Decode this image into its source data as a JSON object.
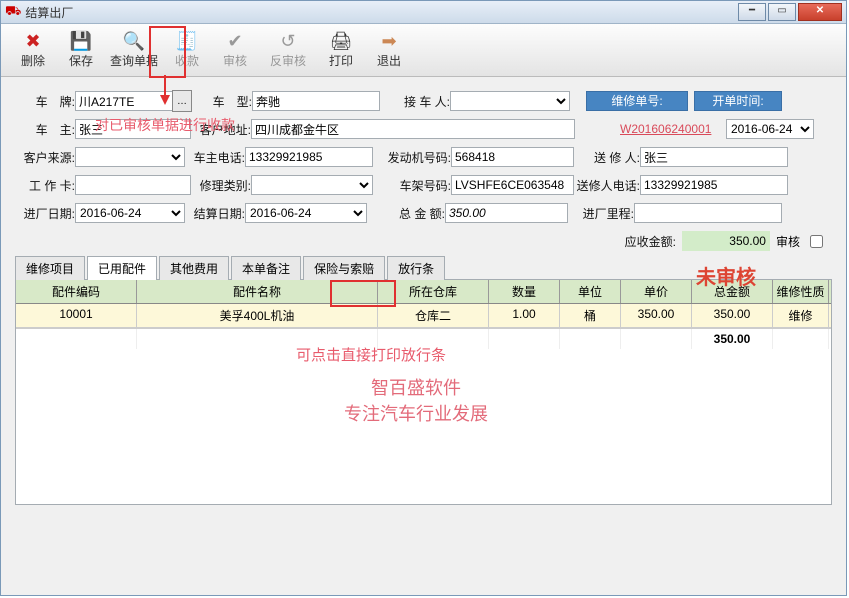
{
  "title": "结算出厂",
  "toolbar": [
    {
      "name": "delete",
      "label": "删除",
      "icon": "✖",
      "color": "#c22"
    },
    {
      "name": "save",
      "label": "保存",
      "icon": "💾",
      "color": "#4a5"
    },
    {
      "name": "query",
      "label": "查询单据",
      "icon": "🔍",
      "color": "#333"
    },
    {
      "name": "collect",
      "label": "收款",
      "icon": "🧾",
      "dis": true
    },
    {
      "name": "audit",
      "label": "审核",
      "icon": "✔",
      "dis": true
    },
    {
      "name": "unaudit",
      "label": "反审核",
      "icon": "↺",
      "dis": true
    },
    {
      "name": "print",
      "label": "打印",
      "icon": "🖨",
      "color": "#333"
    },
    {
      "name": "exit",
      "label": "退出",
      "icon": "➡",
      "color": "#c85"
    }
  ],
  "fields": {
    "plate_lab": "车　牌:",
    "plate": "川A217TE",
    "model_lab": "车　型:",
    "model": "奔驰",
    "receiver_lab": "接 车 人:",
    "owner_lab": "车　主:",
    "owner": "张三",
    "addr_lab": "客户地址:",
    "addr": "四川成都金牛区",
    "src_lab": "客户来源:",
    "phone_lab": "车主电话:",
    "phone": "13329921985",
    "eng_lab": "发动机号码:",
    "eng": "568418",
    "card_lab": "工 作 卡:",
    "rtype_lab": "修理类别:",
    "vin_lab": "车架号码:",
    "vin": "LVSHFE6CE063548",
    "indate_lab": "进厂日期:",
    "indate": "2016-06-24",
    "sdate_lab": "结算日期:",
    "sdate": "2016-06-24",
    "total_lab": "总 金 额:",
    "total": "350.00",
    "due_lab": "应收金额:",
    "due": "350.00",
    "audit_lab": "审核",
    "order_lab": "维修单号:",
    "order": "W201606240001",
    "open_lab": "开单时间:",
    "open": "2016-06-24",
    "sender_lab": "送 修 人:",
    "sender": "张三",
    "sphone_lab": "送修人电话:",
    "sphone": "13329921985",
    "mile_lab": "进厂里程:"
  },
  "tabs": [
    "维修项目",
    "已用配件",
    "其他费用",
    "本单备注",
    "保险与索赔",
    "放行条"
  ],
  "grid": {
    "headers": [
      "配件编码",
      "配件名称",
      "所在仓库",
      "数量",
      "单位",
      "单价",
      "总金额",
      "维修性质"
    ],
    "row": [
      "10001",
      "美孚400L机油",
      "仓库二",
      "1.00",
      "桶",
      "350.00",
      "350.00",
      "维修"
    ],
    "foot_total": "350.00"
  },
  "annot": {
    "tip1": "对已审核单据进行收款",
    "unaudited": "未审核",
    "printtip": "可点击直接打印放行条",
    "wm1": "智百盛软件",
    "wm2": "专注汽车行业发展"
  }
}
